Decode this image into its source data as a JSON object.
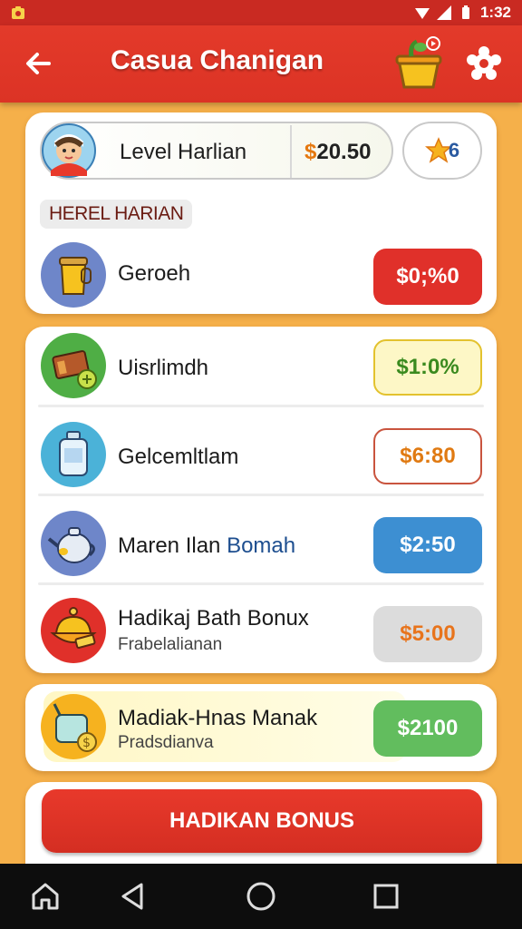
{
  "status_bar": {
    "time": "1:32"
  },
  "app_bar": {
    "title": "Casua Chanigan"
  },
  "level": {
    "label": "Level Harlian",
    "value_symbol": "$",
    "value_amount": "20.50",
    "star_count": "6"
  },
  "section_tag": "HEREL HARIAN",
  "items": [
    {
      "title": "Geroeh",
      "price": "$0;%0",
      "price_bg": "#e0302a",
      "price_color": "#ffffff"
    },
    {
      "title": "Uisrlimdh",
      "price": "$1:0%",
      "price_bg": "#fdf7c6",
      "price_color": "#3a8a1e"
    },
    {
      "title": "Gelcemltlam",
      "price": "$6:80",
      "price_bg": "#ffffff",
      "price_color": "#e07a12"
    },
    {
      "title_main": "Maren Ilan ",
      "title_accent": "Bomah",
      "price": "$2:50",
      "price_bg": "#3d8fd2",
      "price_color": "#ffffff"
    },
    {
      "title": "Hadikaj Bath Bonux",
      "subtitle": "Frabelalianan",
      "price": "$5:00",
      "price_bg": "#dcdcdc",
      "price_color": "#e8741c"
    },
    {
      "title": "Madiak-Hnas Manak",
      "subtitle": "Pradsdianva",
      "price": "$2100",
      "price_bg": "#62bd5e",
      "price_color": "#ffffff"
    }
  ],
  "bonus_button": "HADIKAN BONUS",
  "icons": {
    "back": "arrow-left-icon",
    "cart": "shopping-basket-icon",
    "settings": "gear-icon",
    "home": "home-icon",
    "nav_back": "triangle-back-icon",
    "nav_home": "circle-home-icon",
    "recents": "square-recents-icon"
  },
  "colors": {
    "app_bar": "#dc3325",
    "background": "#f5b04a",
    "accent_blue": "#1d4e8f"
  }
}
